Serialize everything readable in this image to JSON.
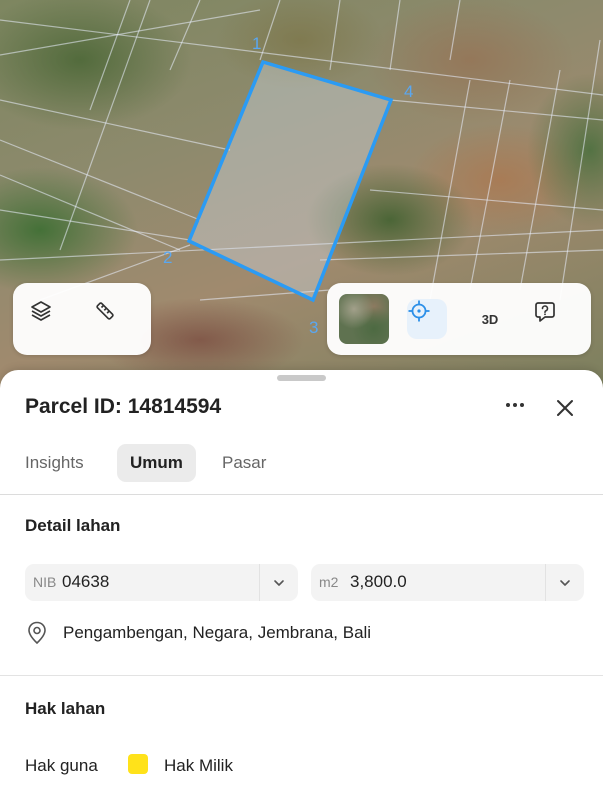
{
  "map": {
    "parcel_vertices": [
      "1",
      "4",
      "2",
      "3"
    ],
    "parcel_color": "#2b9bf4"
  },
  "controls": {
    "layers_icon": "layers-icon",
    "measure_icon": "ruler-icon",
    "locate_icon": "crosshair-icon",
    "three_d_label": "3D",
    "feedback_icon": "chat-feedback-icon"
  },
  "sheet": {
    "title": "Parcel ID: 14814594",
    "tabs": [
      {
        "label": "Insights",
        "active": false
      },
      {
        "label": "Umum",
        "active": true
      },
      {
        "label": "Pasar",
        "active": false
      }
    ],
    "detail_section_title": "Detail lahan",
    "nib": {
      "prefix": "NIB",
      "value": "04638"
    },
    "area": {
      "prefix": "m2",
      "value": "3,800.0"
    },
    "location": "Pengambengan, Negara, Jembrana, Bali",
    "rights_section_title": "Hak lahan",
    "hak_guna": {
      "label": "Hak guna",
      "value": "Hak Milik",
      "swatch_color": "#ffe21a"
    }
  }
}
